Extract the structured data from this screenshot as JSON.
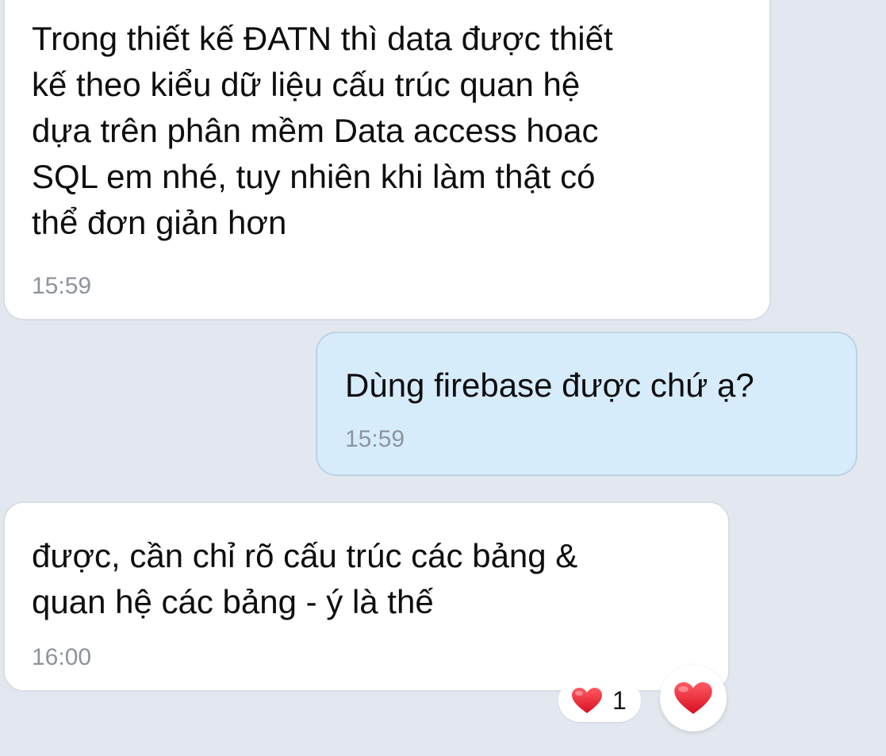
{
  "messages": [
    {
      "direction": "incoming",
      "text": "Trong thiết kế ĐATN thì data được thiết\nkế theo kiểu dữ liệu cấu trúc quan hệ\ndựa trên phân mềm Data access hoac\nSQL em nhé, tuy nhiên khi làm thật có\nthể đơn giản hơn",
      "time": "15:59"
    },
    {
      "direction": "outgoing",
      "text": "Dùng firebase được chứ ạ?",
      "time": "15:59"
    },
    {
      "direction": "incoming",
      "text": "được, cần chỉ rõ cấu trúc các bảng &\nquan hệ các bảng - ý là thế",
      "time": "16:00"
    }
  ],
  "reaction": {
    "icon": "heart-icon",
    "count": "1",
    "color": "#e8192c"
  },
  "colors": {
    "background": "#e3e8f0",
    "incoming_bubble": "#ffffff",
    "outgoing_bubble": "#d6ecfb",
    "timestamp": "#8d949c"
  }
}
